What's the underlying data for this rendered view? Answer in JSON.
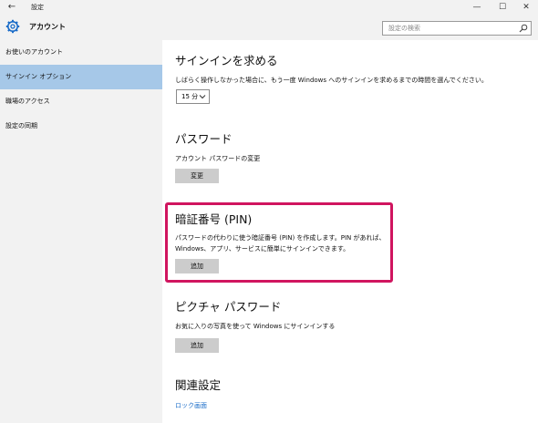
{
  "window": {
    "title": "設定",
    "back_glyph": "←",
    "minimize_glyph": "—",
    "maximize_glyph": "☐",
    "close_glyph": "✕"
  },
  "header": {
    "title": "アカウント",
    "search_placeholder": "設定の検索",
    "icon": "gear-icon"
  },
  "sidebar": {
    "items": [
      {
        "label": "お使いのアカウント",
        "selected": false
      },
      {
        "label": "サインイン オプション",
        "selected": true
      },
      {
        "label": "職場のアクセス",
        "selected": false
      },
      {
        "label": "設定の同期",
        "selected": false
      }
    ]
  },
  "sections": {
    "require_signin": {
      "title": "サインインを求める",
      "description": "しばらく操作しなかった場合に、もう一度 Windows へのサインインを求めるまでの時間を選んでください。",
      "dropdown_value": "15 分"
    },
    "password": {
      "title": "パスワード",
      "description": "アカウント パスワードの変更",
      "button_label": "変更"
    },
    "pin": {
      "title": "暗証番号 (PIN)",
      "description_line1": "パスワードの代わりに使う暗証番号 (PIN) を作成します。PIN があれば、",
      "description_line2": "Windows、アプリ、サービスに簡単にサインインできます。",
      "button_label": "追加",
      "highlight_color": "#d0155f"
    },
    "picture_password": {
      "title": "ピクチャ パスワード",
      "description": "お気に入りの写真を使って Windows にサインインする",
      "button_label": "追加"
    },
    "related": {
      "title": "関連設定",
      "link_label": "ロック画面"
    }
  },
  "colors": {
    "accent_selected": "#a6c8e8",
    "link": "#1a6cc8",
    "sidebar_bg": "#f2f2f2"
  }
}
